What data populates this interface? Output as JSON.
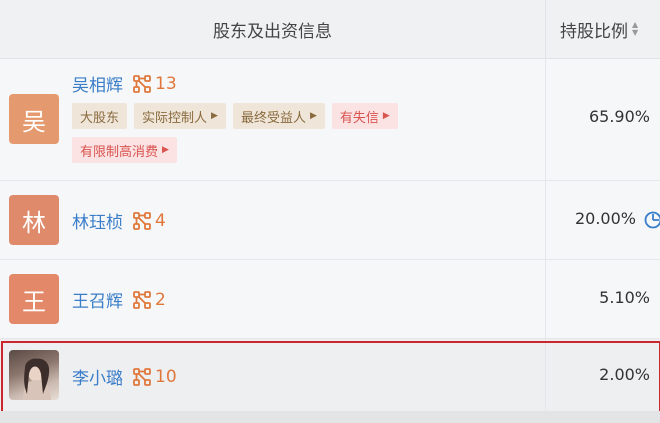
{
  "header": {
    "name_col": "股东及出资信息",
    "ratio_col": "持股比例"
  },
  "rows": [
    {
      "avatar_char": "吴",
      "avatar_color": "#e49a6e",
      "name": "吴相辉",
      "count": "13",
      "ratio": "65.90%",
      "tags": [
        {
          "label": "大股东",
          "style": "brown",
          "arrow": false
        },
        {
          "label": "实际控制人",
          "style": "brown",
          "arrow": true
        },
        {
          "label": "最终受益人",
          "style": "brown",
          "arrow": true
        },
        {
          "label": "有失信",
          "style": "red",
          "arrow": true
        },
        {
          "label": "有限制高消费",
          "style": "red",
          "arrow": true
        }
      ]
    },
    {
      "avatar_char": "林",
      "avatar_color": "#de8a6b",
      "name": "林珏桢",
      "count": "4",
      "ratio": "20.00%",
      "tags": []
    },
    {
      "avatar_char": "王",
      "avatar_color": "#e3896a",
      "name": "王召辉",
      "count": "2",
      "ratio": "5.10%",
      "tags": []
    },
    {
      "avatar_char": "",
      "avatar_color": "#7d6b65",
      "name": "李小璐",
      "count": "10",
      "ratio": "2.00%",
      "tags": [],
      "photo": true
    }
  ],
  "colors": {
    "link": "#3a7dc9",
    "count": "#e0783c",
    "highlight": "#c9282d"
  }
}
